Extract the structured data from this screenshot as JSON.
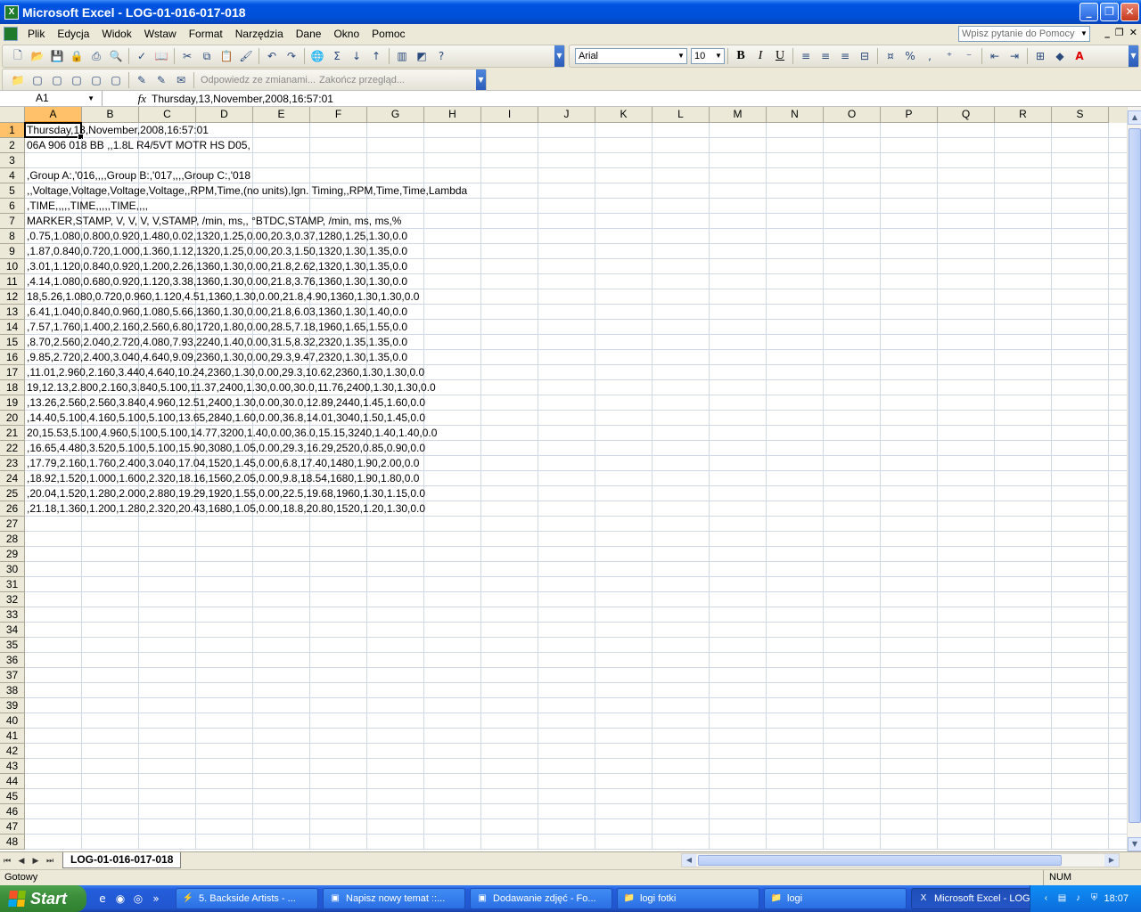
{
  "window": {
    "title": "Microsoft Excel - LOG-01-016-017-018"
  },
  "menu": [
    "Plik",
    "Edycja",
    "Widok",
    "Wstaw",
    "Format",
    "Narzędzia",
    "Dane",
    "Okno",
    "Pomoc"
  ],
  "help_box": {
    "placeholder": "Wpisz pytanie do Pomocy"
  },
  "format_toolbar": {
    "font": "Arial",
    "size": "10"
  },
  "review_toolbar": {
    "reply": "Odpowiedz ze zmianami...",
    "end": "Zakończ przegląd..."
  },
  "formula_bar": {
    "name_box": "A1",
    "fx": "fx",
    "content": "Thursday,13,November,2008,16:57:01"
  },
  "columns": [
    "A",
    "B",
    "C",
    "D",
    "E",
    "F",
    "G",
    "H",
    "I",
    "J",
    "K",
    "L",
    "M",
    "N",
    "O",
    "P",
    "Q",
    "R",
    "S"
  ],
  "rows": [
    {
      "n": "1",
      "a": "Thursday,13,November,2008,16:57:01"
    },
    {
      "n": "2",
      "a": "06A 906 018 BB  ,,1.8L R4/5VT MOTR HS D05,"
    },
    {
      "n": "3",
      "a": ""
    },
    {
      "n": "4",
      "a": ",Group A:,'016,,,,Group B:,'017,,,,Group C:,'018"
    },
    {
      "n": "5",
      "a": ",,Voltage,Voltage,Voltage,Voltage,,RPM,Time,(no units),Ign. Timing,,RPM,Time,Time,Lambda"
    },
    {
      "n": "6",
      "a": ",TIME,,,,,TIME,,,,,TIME,,,,"
    },
    {
      "n": "7",
      "a": "MARKER,STAMP, V, V, V, V,STAMP, /min, ms,, °BTDC,STAMP, /min, ms, ms,%"
    },
    {
      "n": "8",
      "a": ",0.75,1.080,0.800,0.920,1.480,0.02,1320,1.25,0.00,20.3,0.37,1280,1.25,1.30,0.0"
    },
    {
      "n": "9",
      "a": ",1.87,0.840,0.720,1.000,1.360,1.12,1320,1.25,0.00,20.3,1.50,1320,1.30,1.35,0.0"
    },
    {
      "n": "10",
      "a": ",3.01,1.120,0.840,0.920,1.200,2.26,1360,1.30,0.00,21.8,2.62,1320,1.30,1.35,0.0"
    },
    {
      "n": "11",
      "a": ",4.14,1.080,0.680,0.920,1.120,3.38,1360,1.30,0.00,21.8,3.76,1360,1.30,1.30,0.0"
    },
    {
      "n": "12",
      "a": "18,5.26,1.080,0.720,0.960,1.120,4.51,1360,1.30,0.00,21.8,4.90,1360,1.30,1.30,0.0"
    },
    {
      "n": "13",
      "a": ",6.41,1.040,0.840,0.960,1.080,5.66,1360,1.30,0.00,21.8,6.03,1360,1.30,1.40,0.0"
    },
    {
      "n": "14",
      "a": ",7.57,1.760,1.400,2.160,2.560,6.80,1720,1.80,0.00,28.5,7.18,1960,1.65,1.55,0.0"
    },
    {
      "n": "15",
      "a": ",8.70,2.560,2.040,2.720,4.080,7.93,2240,1.40,0.00,31.5,8.32,2320,1.35,1.35,0.0"
    },
    {
      "n": "16",
      "a": ",9.85,2.720,2.400,3.040,4.640,9.09,2360,1.30,0.00,29.3,9.47,2320,1.30,1.35,0.0"
    },
    {
      "n": "17",
      "a": ",11.01,2.960,2.160,3.440,4.640,10.24,2360,1.30,0.00,29.3,10.62,2360,1.30,1.30,0.0"
    },
    {
      "n": "18",
      "a": "19,12.13,2.800,2.160,3.840,5.100,11.37,2400,1.30,0.00,30.0,11.76,2400,1.30,1.30,0.0"
    },
    {
      "n": "19",
      "a": ",13.26,2.560,2.560,3.840,4.960,12.51,2400,1.30,0.00,30.0,12.89,2440,1.45,1.60,0.0"
    },
    {
      "n": "20",
      "a": ",14.40,5.100,4.160,5.100,5.100,13.65,2840,1.60,0.00,36.8,14.01,3040,1.50,1.45,0.0"
    },
    {
      "n": "21",
      "a": "20,15.53,5.100,4.960,5.100,5.100,14.77,3200,1.40,0.00,36.0,15.15,3240,1.40,1.40,0.0"
    },
    {
      "n": "22",
      "a": ",16.65,4.480,3.520,5.100,5.100,15.90,3080,1.05,0.00,29.3,16.29,2520,0.85,0.90,0.0"
    },
    {
      "n": "23",
      "a": ",17.79,2.160,1.760,2.400,3.040,17.04,1520,1.45,0.00,6.8,17.40,1480,1.90,2.00,0.0"
    },
    {
      "n": "24",
      "a": ",18.92,1.520,1.000,1.600,2.320,18.16,1560,2.05,0.00,9.8,18.54,1680,1.90,1.80,0.0"
    },
    {
      "n": "25",
      "a": ",20.04,1.520,1.280,2.000,2.880,19.29,1920,1.55,0.00,22.5,19.68,1960,1.30,1.15,0.0"
    },
    {
      "n": "26",
      "a": ",21.18,1.360,1.200,1.280,2.320,20.43,1680,1.05,0.00,18.8,20.80,1520,1.20,1.30,0.0"
    },
    {
      "n": "27",
      "a": ""
    },
    {
      "n": "28",
      "a": ""
    },
    {
      "n": "29",
      "a": ""
    },
    {
      "n": "30",
      "a": ""
    },
    {
      "n": "31",
      "a": ""
    },
    {
      "n": "32",
      "a": ""
    },
    {
      "n": "33",
      "a": ""
    },
    {
      "n": "34",
      "a": ""
    },
    {
      "n": "35",
      "a": ""
    },
    {
      "n": "36",
      "a": ""
    },
    {
      "n": "37",
      "a": ""
    },
    {
      "n": "38",
      "a": ""
    },
    {
      "n": "39",
      "a": ""
    },
    {
      "n": "40",
      "a": ""
    },
    {
      "n": "41",
      "a": ""
    },
    {
      "n": "42",
      "a": ""
    },
    {
      "n": "43",
      "a": ""
    },
    {
      "n": "44",
      "a": ""
    },
    {
      "n": "45",
      "a": ""
    },
    {
      "n": "46",
      "a": ""
    },
    {
      "n": "47",
      "a": ""
    },
    {
      "n": "48",
      "a": ""
    }
  ],
  "sheet_tab": "LOG-01-016-017-018",
  "status": {
    "left": "Gotowy",
    "num": "NUM"
  },
  "taskbar": {
    "start": "Start",
    "items": [
      "5. Backside Artists - ...",
      "Napisz nowy temat ::...",
      "Dodawanie zdjęć - Fo...",
      "logi fotki",
      "logi",
      "Microsoft Excel - LOG..."
    ],
    "clock": "18:07"
  },
  "colors": {
    "accent": "#0054e3",
    "selected_header": "#ffc16a",
    "grid": "#d0d7e5"
  }
}
